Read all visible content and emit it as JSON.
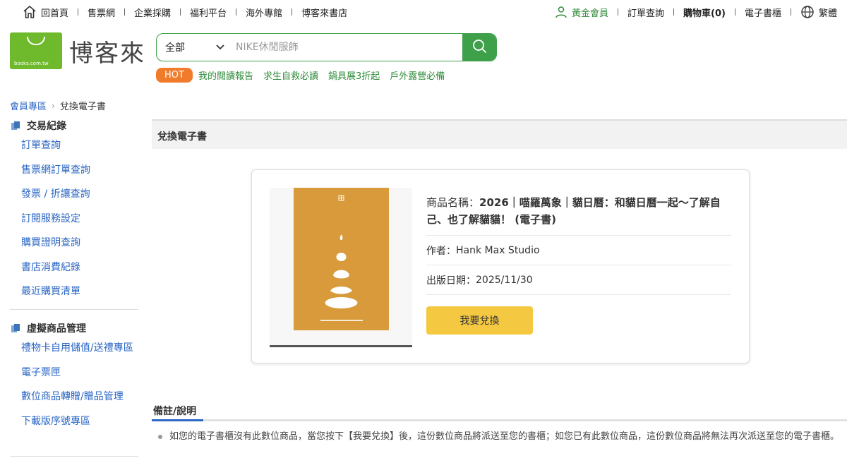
{
  "topnav": {
    "home": "回首頁",
    "items": [
      "售票網",
      "企業採購",
      "福利平台",
      "海外專館",
      "博客來書店"
    ]
  },
  "user_nav": {
    "member": "黃金會員",
    "orders": "訂單查詢",
    "cart": "購物車(0)",
    "ebook_shelf": "電子書櫃",
    "language": "繁體"
  },
  "logo": {
    "text": "博客來",
    "tag": "books.com.tw"
  },
  "search": {
    "scope": "全部",
    "placeholder": "NIKE休閒服飾"
  },
  "hot": {
    "badge": "HOT",
    "links": [
      "我的閱讀報告",
      "求生自救必讀",
      "鍋具展3折起",
      "戶外露營必備"
    ]
  },
  "breadcrumb": {
    "parent": "會員專區",
    "current": "兌換電子書"
  },
  "sidebar": {
    "section1": {
      "title": "交易紀錄",
      "items": [
        "訂單查詢",
        "售票網訂單查詢",
        "發票 / 折讓查詢",
        "訂閱服務設定",
        "購買證明查詢",
        "書店消費紀錄",
        "最近購買清單"
      ]
    },
    "section2": {
      "title": "虛擬商品管理",
      "items": [
        "禮物卡自用儲值/送禮專區",
        "電子票匣",
        "數位商品轉贈/贈品管理",
        "下載版序號專區"
      ]
    }
  },
  "panel": {
    "title": "兌換電子書"
  },
  "product": {
    "name_label": "商品名稱：",
    "name": "2026｜喵羅萬象｜貓日曆：和貓日曆一起～了解自己、也了解貓貓！ (電子書)",
    "author_label": "作者：",
    "author": "Hank Max Studio",
    "date_label": "出版日期：",
    "date": "2025/11/30",
    "button": "我要兌換"
  },
  "notes": {
    "title": "備註/說明",
    "items": [
      "如您的電子書櫃沒有此數位商品，當您按下【我要兌換】後，這份數位商品將派送至您的書櫃；如您已有此數位商品，這份數位商品將無法再次派送至您的電子書櫃。"
    ]
  },
  "colors": {
    "brand_green": "#3fa04a",
    "link_blue": "#2a66c4",
    "hot_orange": "#f07b2a",
    "button_yellow": "#f5c842",
    "cover_orange": "#d89a3a"
  }
}
